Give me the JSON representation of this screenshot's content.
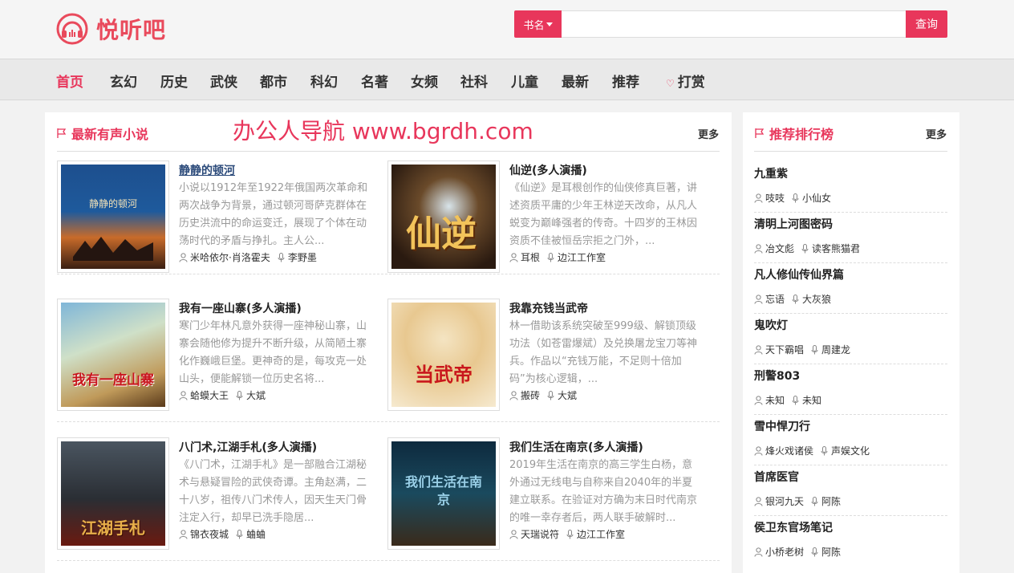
{
  "header": {
    "site_name": "悦听吧",
    "search_type": "书名",
    "search_placeholder": "",
    "search_button": "查询"
  },
  "nav": {
    "items": [
      "首页",
      "玄幻",
      "历史",
      "武侠",
      "都市",
      "科幻",
      "名著",
      "女频",
      "社科",
      "儿童",
      "最新",
      "推荐"
    ],
    "donate": "打赏"
  },
  "watermark": "办公人导航  www.bgrdh.com",
  "latest": {
    "title": "最新有声小说",
    "more": "更多",
    "books": [
      {
        "title": "静静的顿河",
        "desc": "小说以1912年至1922年俄国两次革命和两次战争为背景，通过顿河哥萨克群体在历史洪流中的命运变迁，展现了个体在动荡时代的矛盾与挣扎。主人公...",
        "author": "米哈依尔·肖洛霍夫",
        "narrator": "李野墨",
        "cover_text": "静静的顿河"
      },
      {
        "title": "仙逆(多人演播)",
        "desc": "《仙逆》是耳根创作的仙侠修真巨著，讲述资质平庸的少年王林逆天改命，从凡人蜕变为巅峰强者的传奇。十四岁的王林因资质不佳被恒岳宗拒之门外，...",
        "author": "耳根",
        "narrator": "边江工作室",
        "cover_text": "仙逆"
      },
      {
        "title": "我有一座山寨(多人演播)",
        "desc": "寒门少年林凡意外获得一座神秘山寨，山寨会随他修为提升不断升级，从简陋土寨化作巍峨巨堡。更神奇的是，每攻克一处山头，便能解锁一位历史名将...",
        "author": "蛤蟆大王",
        "narrator": "大斌",
        "cover_text": "我有一座山寨"
      },
      {
        "title": "我靠充钱当武帝",
        "desc": "林一借助该系统突破至999级、解锁顶级功法（如苍雷爆斌）及兑换屠龙宝刀等神兵。作品以“充钱万能，不足则十倍加码”为核心逻辑，...",
        "author": "搬砖",
        "narrator": "大斌",
        "cover_text": "当武帝"
      },
      {
        "title": "八门术,江湖手札(多人演播)",
        "desc": "《八门术，江湖手札》是一部融合江湖秘术与悬疑冒险的武侠奇谭。主角赵满，二十八岁，祖传八门术传人，因天生天门骨注定入行，却早已洗手隐居...",
        "author": "锦衣夜城",
        "narrator": "蛐蛐",
        "cover_text": "江湖手札"
      },
      {
        "title": "我们生活在南京(多人演播)",
        "desc": "2019年生活在南京的高三学生白杨，意外通过无线电与自称来自2040年的半夏建立联系。在验证对方确为末日时代南京的唯一幸存者后，两人联手破解时...",
        "author": "天瑞说符",
        "narrator": "边江工作室",
        "cover_text": "我们生活在南京"
      }
    ]
  },
  "ranking": {
    "title": "推荐排行榜",
    "more": "更多",
    "items": [
      {
        "title": "九重紫",
        "author": "吱吱",
        "narrator": "小仙女"
      },
      {
        "title": "清明上河图密码",
        "author": "冶文彪",
        "narrator": "读客熊猫君"
      },
      {
        "title": "凡人修仙传仙界篇",
        "author": "忘语",
        "narrator": "大灰狼"
      },
      {
        "title": "鬼吹灯",
        "author": "天下霸唱",
        "narrator": "周建龙"
      },
      {
        "title": "刑警803",
        "author": "未知",
        "narrator": "未知"
      },
      {
        "title": "雪中悍刀行",
        "author": "烽火戏诸侯",
        "narrator": "声娱文化"
      },
      {
        "title": "首席医官",
        "author": "银河九天",
        "narrator": "阿陈"
      },
      {
        "title": "侯卫东官场笔记",
        "author": "小桥老树",
        "narrator": "阿陈"
      }
    ]
  },
  "colors": {
    "accent": "#e8365b"
  }
}
